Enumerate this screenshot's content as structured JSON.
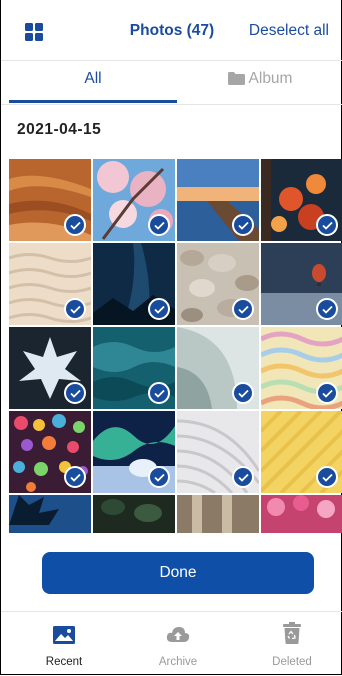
{
  "header": {
    "title": "Photos (47)",
    "deselect_label": "Deselect all"
  },
  "tabs": [
    {
      "label": "All",
      "active": true
    },
    {
      "label": "Album",
      "active": false
    }
  ],
  "section": {
    "date": "2021-04-15"
  },
  "photos": [
    {
      "name": "photo-desert-dunes",
      "selected": true
    },
    {
      "name": "photo-cherry-blossom",
      "selected": true
    },
    {
      "name": "photo-pier-sunset",
      "selected": true
    },
    {
      "name": "photo-autumn-leaves",
      "selected": true
    },
    {
      "name": "photo-white-waves",
      "selected": true
    },
    {
      "name": "photo-night-sky",
      "selected": true
    },
    {
      "name": "photo-pebbles",
      "selected": true
    },
    {
      "name": "photo-hot-air-balloon",
      "selected": true
    },
    {
      "name": "photo-maple-leaf-light",
      "selected": true
    },
    {
      "name": "photo-ocean-waves",
      "selected": true
    },
    {
      "name": "photo-curved-wall",
      "selected": true
    },
    {
      "name": "photo-rainbow-waves",
      "selected": true
    },
    {
      "name": "photo-colorful-dots",
      "selected": true
    },
    {
      "name": "photo-aurora-igloo",
      "selected": true
    },
    {
      "name": "photo-white-spiral",
      "selected": true
    },
    {
      "name": "photo-yellow-pattern",
      "selected": true
    },
    {
      "name": "photo-palm-silhouette",
      "selected": false
    },
    {
      "name": "photo-dark-leaves",
      "selected": false
    },
    {
      "name": "photo-architecture",
      "selected": false
    },
    {
      "name": "photo-pink-flowers",
      "selected": false
    }
  ],
  "done_label": "Done",
  "bottom_nav": [
    {
      "label": "Recent",
      "icon": "image-icon",
      "active": true
    },
    {
      "label": "Archive",
      "icon": "cloud-upload-icon",
      "active": false
    },
    {
      "label": "Deleted",
      "icon": "trash-recycle-icon",
      "active": false
    }
  ],
  "colors": {
    "accent": "#1a4c9e",
    "button": "#0f4fa8",
    "inactive": "#9a9a9a"
  }
}
